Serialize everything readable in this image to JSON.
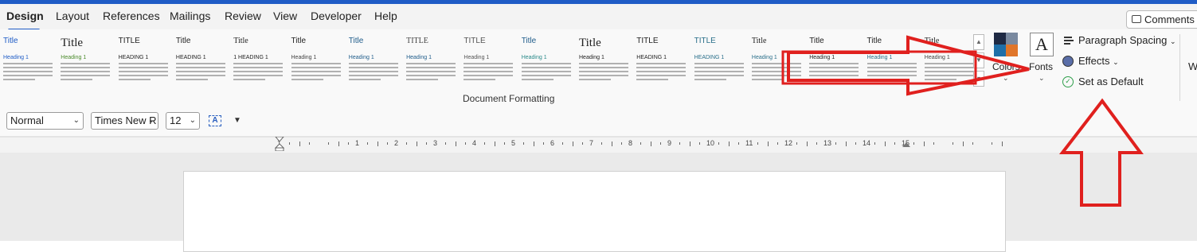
{
  "tabs": [
    {
      "label": "Design",
      "active": true
    },
    {
      "label": "Layout"
    },
    {
      "label": "References"
    },
    {
      "label": "Mailings"
    },
    {
      "label": "Review"
    },
    {
      "label": "View"
    },
    {
      "label": "Developer"
    },
    {
      "label": "Help"
    }
  ],
  "comments_label": "Comments",
  "gallery": {
    "group_label": "Document Formatting",
    "themes": [
      {
        "title": "Title",
        "heading": "Heading 1",
        "title_color": "#1f5cc6",
        "heading_color": "#1f5cc6"
      },
      {
        "title": "Title",
        "heading": "Heading 1",
        "title_color": "#222222",
        "heading_color": "#4a8a2a"
      },
      {
        "title": "TITLE",
        "heading": "HEADING 1",
        "title_color": "#222222",
        "heading_color": "#222222"
      },
      {
        "title": "Title",
        "heading": "HEADING 1",
        "title_color": "#222222",
        "heading_color": "#222222"
      },
      {
        "title": "Title",
        "heading": "1  HEADING 1",
        "title_color": "#222222",
        "heading_color": "#222222"
      },
      {
        "title": "Title",
        "heading": "Heading 1",
        "title_color": "#222222",
        "heading_color": "#444444"
      },
      {
        "title": "Title",
        "heading": "Heading 1",
        "title_color": "#1f5c8a",
        "heading_color": "#1f5c8a"
      },
      {
        "title": "TITLE",
        "heading": "Heading 1",
        "title_color": "#444444",
        "heading_color": "#1f5c8a"
      },
      {
        "title": "TITLE",
        "heading": "Heading 1",
        "title_color": "#555555",
        "heading_color": "#555555"
      },
      {
        "title": "Title",
        "heading": "Heading 1",
        "title_color": "#1f5c8a",
        "heading_color": "#2a8a8a"
      },
      {
        "title": "Title",
        "heading": "Heading 1",
        "title_color": "#222222",
        "heading_color": "#222222"
      },
      {
        "title": "TITLE",
        "heading": "HEADING 1",
        "title_color": "#222222",
        "heading_color": "#222222"
      },
      {
        "title": "TITLE",
        "heading": "HEADING 1",
        "title_color": "#2a6f8a",
        "heading_color": "#2a6f8a"
      },
      {
        "title": "Title",
        "heading": "Heading 1",
        "title_color": "#222222",
        "heading_color": "#2a6f8a"
      },
      {
        "title": "Title",
        "heading": "Heading 1",
        "title_color": "#222222",
        "heading_color": "#222222"
      },
      {
        "title": "Title",
        "heading": "Heading 1",
        "title_color": "#222222",
        "heading_color": "#2a6f8a"
      },
      {
        "title": "Title",
        "heading": "Heading 1",
        "title_color": "#222222",
        "heading_color": "#444444"
      }
    ]
  },
  "colors": {
    "label": "Colors",
    "swatches": [
      "#1f2a44",
      "#7a8aa0",
      "#1f6fa8",
      "#e0762a"
    ]
  },
  "fonts": {
    "label": "Fonts",
    "glyph": "A"
  },
  "options": {
    "paragraph_spacing": "Paragraph Spacing",
    "effects": "Effects",
    "set_default": "Set as Default"
  },
  "watermark_partial": "W",
  "toolbar": {
    "style": "Normal",
    "font": "Times New R",
    "size": "12"
  },
  "ruler": {
    "numbers": [
      "1",
      "1",
      "2",
      "3",
      "4",
      "5",
      "6",
      "7",
      "8",
      "9",
      "10",
      "11",
      "12",
      "13",
      "14",
      "15"
    ]
  },
  "annotation_color": "#e0201e"
}
